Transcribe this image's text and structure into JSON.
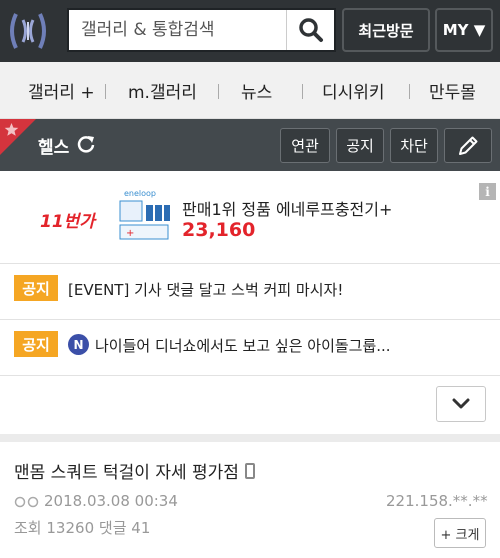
{
  "header": {
    "search_placeholder": "갤러리 & 통합검색",
    "recent_label": "최근방문",
    "my_label": "MY ▼"
  },
  "nav": {
    "items": [
      {
        "label": "갤러리 +"
      },
      {
        "label": "m.갤러리"
      },
      {
        "label": "뉴스"
      },
      {
        "label": "디시위키"
      },
      {
        "label": "만두몰"
      }
    ]
  },
  "gallery": {
    "title": "헬스",
    "buttons": [
      "연관",
      "공지",
      "차단"
    ]
  },
  "ad": {
    "brand": "11번가",
    "product_text": "판매1위 정품 에네루프충전기+",
    "price": "23,160",
    "info_label": "i"
  },
  "notices": [
    {
      "badge": "공지",
      "text": "[EVENT] 기사 댓글 달고 스벅 커피 마시자!"
    },
    {
      "badge": "공지",
      "icon_letter": "N",
      "text": "나이들어 디너쇼에서도 보고 싶은 아이돌그룹..."
    }
  ],
  "post": {
    "title": "맨몸 스쿼트 턱걸이 자세 평가점",
    "date": "2018.03.08 00:34",
    "ip": "221.158.**.**",
    "views_label": "조회",
    "views": "13260",
    "comments_label": "댓글",
    "comments": "41",
    "expand_label": "+ 크게"
  },
  "colors": {
    "header_bg": "#2f3336",
    "gallery_bar_bg": "#43494d",
    "accent_red": "#e3242b",
    "badge_orange": "#f5a623"
  }
}
